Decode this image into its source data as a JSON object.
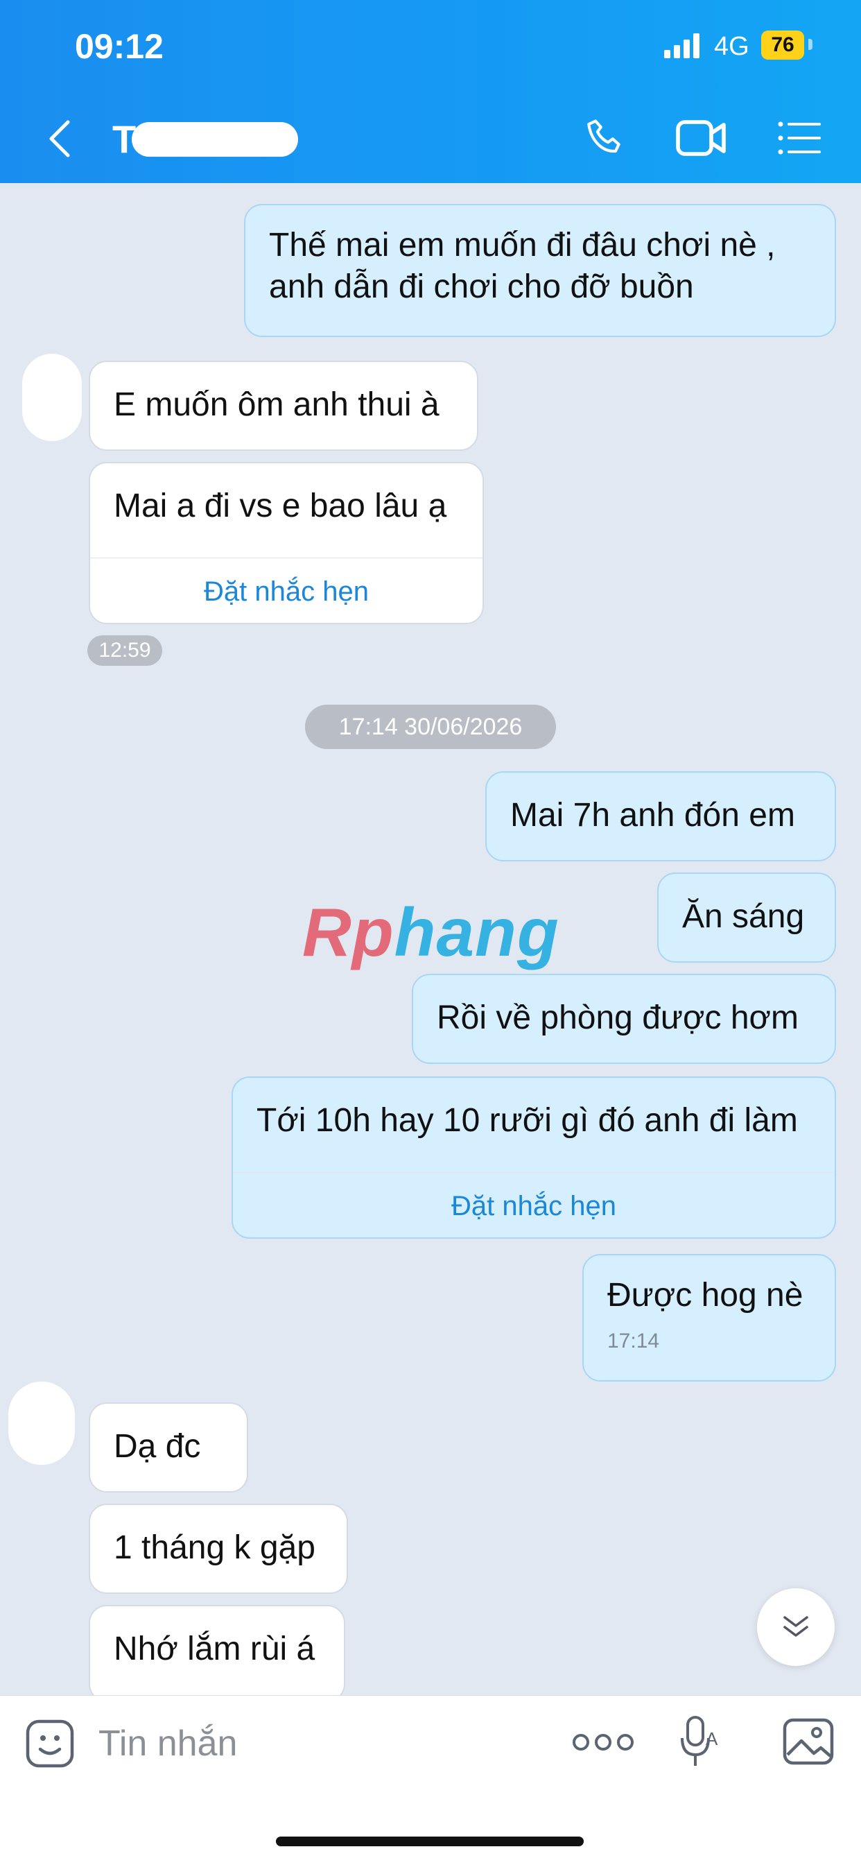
{
  "status_bar": {
    "time": "09:12",
    "network": "4G",
    "battery": "76"
  },
  "header": {
    "title": "T",
    "icons": [
      "back-icon",
      "phone-icon",
      "video-call-icon",
      "menu-list-icon"
    ]
  },
  "messages": [
    {
      "side": "sent",
      "text": "Thế mai em muốn đi đâu chơi nè ,\nanh dẫn đi chơi cho đỡ buồn"
    },
    {
      "side": "received",
      "text": "E muốn ôm anh thui à"
    },
    {
      "side": "received",
      "text": "Mai a đi vs e bao lâu ạ",
      "action": "Đặt nhắc hẹn"
    },
    {
      "side": "received-time",
      "text": "12:59"
    },
    {
      "side": "date",
      "text": "17:14 30/06/2026"
    },
    {
      "side": "sent",
      "text": "Mai 7h anh đón em"
    },
    {
      "side": "sent",
      "text": "Ăn sáng"
    },
    {
      "side": "sent",
      "text": "Rồi về phòng được hơm"
    },
    {
      "side": "sent",
      "text": "Tới 10h hay 10 rưỡi gì đó anh đi làm",
      "action": "Đặt nhắc hẹn"
    },
    {
      "side": "sent",
      "text": "Được hog nè",
      "time": "17:14"
    },
    {
      "side": "received",
      "text": "Dạ đc"
    },
    {
      "side": "received",
      "text": "1 tháng k gặp"
    },
    {
      "side": "received",
      "text": "Nhớ lắm rùi á"
    }
  ],
  "watermark": {
    "part1": "Rp",
    "part2": "hang"
  },
  "composer": {
    "placeholder": "Tin nhắn"
  },
  "colors": {
    "header_from": "#1a8ef0",
    "header_to": "#14a6f5",
    "sent_bubble": "#d6efff",
    "received_bubble": "#ffffff",
    "background": "#e2e8f1",
    "link": "#1b87d8"
  }
}
